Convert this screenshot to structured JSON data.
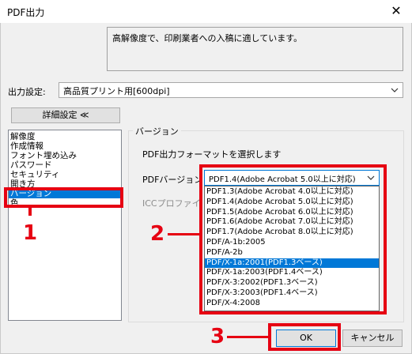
{
  "window": {
    "title": "PDF出力",
    "close_glyph": "✕"
  },
  "description": "高解像度で、印刷業者への入稿に適しています。",
  "output_setting": {
    "label": "出力設定:",
    "value": "高品質プリント用[600dpi]"
  },
  "detail_button": {
    "label": "詳細設定 ≪"
  },
  "sidebar": {
    "items": [
      {
        "label": "解像度"
      },
      {
        "label": "作成情報"
      },
      {
        "label": "フォント埋め込み"
      },
      {
        "label": "パスワード"
      },
      {
        "label": "セキュリティ"
      },
      {
        "label": "開き方"
      },
      {
        "label": "バージョン"
      },
      {
        "label": "色"
      }
    ],
    "selected_index": 6
  },
  "version_group": {
    "caption": "バージョン",
    "instruction": "PDF出力フォーマットを選択します",
    "pdf_version_label": "PDFバージョン",
    "pdf_version_value": "PDF1.4(Adobe Acrobat 5.0以上に対応)",
    "icc_label": "ICCプロファイル"
  },
  "dropdown_options": [
    "PDF1.3(Adobe Acrobat 4.0以上に対応)",
    "PDF1.4(Adobe Acrobat 5.0以上に対応)",
    "PDF1.5(Adobe Acrobat 6.0以上に対応)",
    "PDF1.6(Adobe Acrobat 7.0以上に対応)",
    "PDF1.7(Adobe Acrobat 8.0以上に対応)",
    "PDF/A-1b:2005",
    "PDF/A-2b",
    "PDF/X-1a:2001(PDF1.3ベース)",
    "PDF/X-1a:2003(PDF1.4ベース)",
    "PDF/X-3:2002(PDF1.3ベース)",
    "PDF/X-3:2003(PDF1.4ベース)",
    "PDF/X-4:2008"
  ],
  "dropdown_highlight_index": 7,
  "buttons": {
    "ok": "OK",
    "cancel": "キャンセル"
  },
  "annotations": {
    "step1": "1",
    "step2": "2",
    "step3": "3",
    "accent_color": "#e60012"
  },
  "icons": {
    "close": "close-icon",
    "combo_arrow": "chevron-down-icon"
  }
}
